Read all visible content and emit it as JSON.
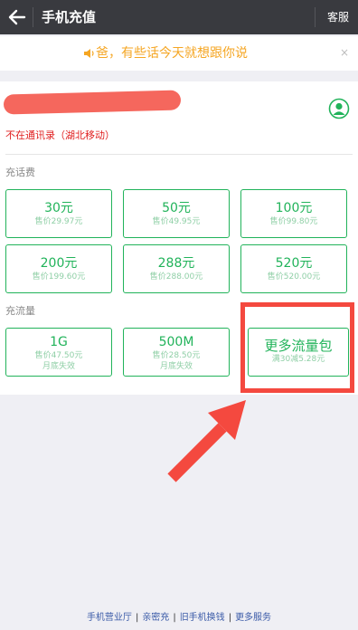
{
  "header": {
    "title": "手机充值",
    "service_label": "客服"
  },
  "notice": {
    "text": "爸，有些话今天就想跟你说",
    "close": "×"
  },
  "account": {
    "carrier_status": "不在通讯录（湖北移动）"
  },
  "recharge": {
    "section_label": "充话费",
    "options": [
      {
        "amount": "30元",
        "price": "售价29.97元"
      },
      {
        "amount": "50元",
        "price": "售价49.95元"
      },
      {
        "amount": "100元",
        "price": "售价99.80元"
      },
      {
        "amount": "200元",
        "price": "售价199.60元"
      },
      {
        "amount": "288元",
        "price": "售价288.00元"
      },
      {
        "amount": "520元",
        "price": "售价520.00元"
      }
    ]
  },
  "data_plans": {
    "section_label": "充流量",
    "options": [
      {
        "amount": "1G",
        "price": "售价47.50元",
        "note": "月底失效"
      },
      {
        "amount": "500M",
        "price": "售价28.50元",
        "note": "月底失效"
      }
    ],
    "more": {
      "label": "更多流量包",
      "promo": "满30减5.28元"
    }
  },
  "footer": {
    "links": [
      "手机营业厅",
      "亲密充",
      "旧手机换钱",
      "更多服务"
    ],
    "separator": "|"
  },
  "colors": {
    "accent_green": "#21b35a",
    "notice_orange": "#f5a623",
    "status_red": "#e02020",
    "annotation_red": "#f4493f"
  }
}
